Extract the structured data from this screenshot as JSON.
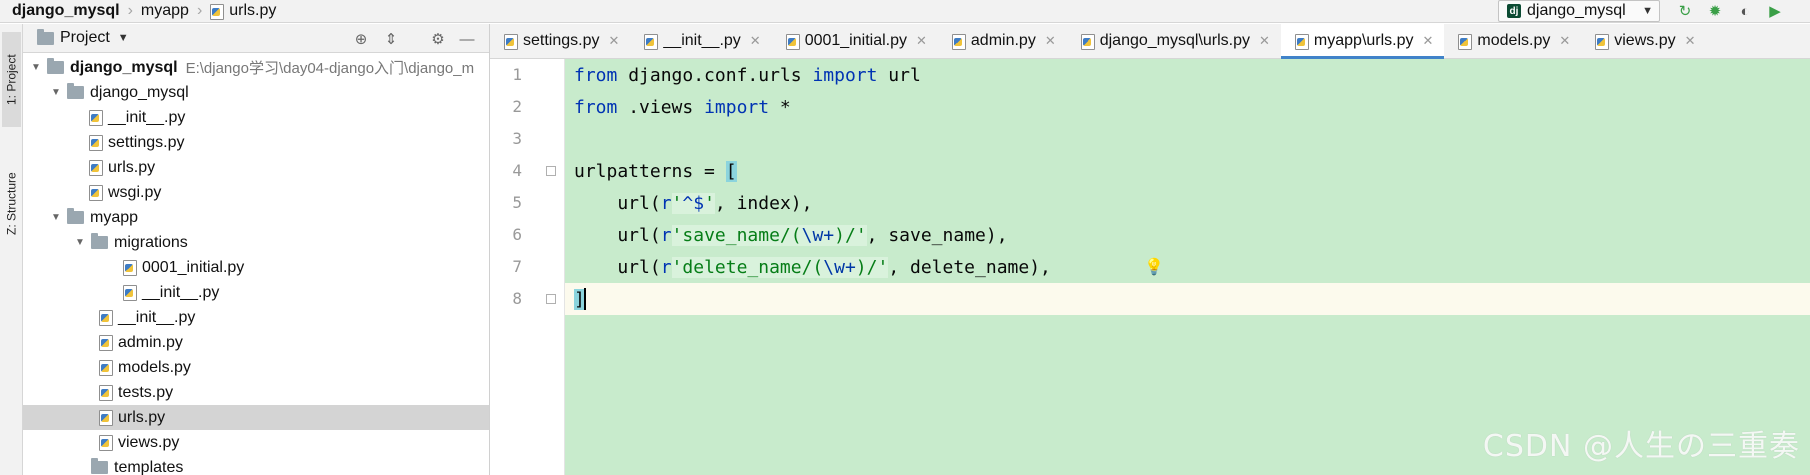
{
  "breadcrumb": {
    "items": [
      "django_mysql",
      "myapp",
      "urls.py"
    ]
  },
  "toolbar": {
    "run_config": "django_mysql",
    "run_config_icon": "dj"
  },
  "toolstrip": {
    "tabs": [
      "1: Project",
      "Z: Structure"
    ]
  },
  "project_panel": {
    "title": "Project",
    "tree": [
      {
        "label": "django_mysql",
        "path": "E:\\django学习\\day04-django入门\\django_m",
        "kind": "root"
      },
      {
        "label": "django_mysql",
        "kind": "package"
      },
      {
        "label": "__init__.py",
        "kind": "file"
      },
      {
        "label": "settings.py",
        "kind": "file"
      },
      {
        "label": "urls.py",
        "kind": "file"
      },
      {
        "label": "wsgi.py",
        "kind": "file"
      },
      {
        "label": "myapp",
        "kind": "package"
      },
      {
        "label": "migrations",
        "kind": "package"
      },
      {
        "label": "0001_initial.py",
        "kind": "file"
      },
      {
        "label": "__init__.py",
        "kind": "file"
      },
      {
        "label": "__init__.py",
        "kind": "file"
      },
      {
        "label": "admin.py",
        "kind": "file"
      },
      {
        "label": "models.py",
        "kind": "file"
      },
      {
        "label": "tests.py",
        "kind": "file"
      },
      {
        "label": "urls.py",
        "kind": "file",
        "selected": true
      },
      {
        "label": "views.py",
        "kind": "file"
      },
      {
        "label": "templates",
        "kind": "folder"
      }
    ]
  },
  "editor": {
    "tabs": [
      {
        "label": "settings.py"
      },
      {
        "label": "__init__.py"
      },
      {
        "label": "0001_initial.py"
      },
      {
        "label": "admin.py"
      },
      {
        "label": "django_mysql\\urls.py"
      },
      {
        "label": "myapp\\urls.py",
        "active": true
      },
      {
        "label": "models.py"
      },
      {
        "label": "views.py"
      }
    ],
    "line_numbers": [
      "1",
      "2",
      "3",
      "4",
      "5",
      "6",
      "7",
      "8"
    ],
    "code": {
      "l1": {
        "kw1": "from",
        "mod": " django.conf.urls ",
        "kw2": "import",
        "name": " url"
      },
      "l2": {
        "kw1": "from",
        "mod": " .views ",
        "kw2": "import",
        "name": " *"
      },
      "l4": {
        "lhs": "urlpatterns = ",
        "bracket": "["
      },
      "l5": {
        "pre": "    url(",
        "r": "r",
        "q1": "'",
        "s1": "^$",
        "q2": "'",
        "post": ", index),"
      },
      "l6": {
        "pre": "    url(",
        "r": "r",
        "q1": "'",
        "s1": "save_name/(",
        "esc": "\\w+",
        "s2": ")/",
        "q2": "'",
        "post": ", save_name),"
      },
      "l7": {
        "pre": "    url(",
        "r": "r",
        "q1": "'",
        "s1": "delete_name/(",
        "esc": "\\w+",
        "s2": ")/",
        "q2": "'",
        "post": ", delete_name),"
      },
      "l8": {
        "bracket": "]"
      }
    }
  },
  "watermark": "CSDN @人生の三重奏",
  "colors": {
    "code_background": "#c8ebcc",
    "keyword": "#0033b3",
    "string": "#067d17",
    "active_tab_underline": "#4083c9"
  }
}
